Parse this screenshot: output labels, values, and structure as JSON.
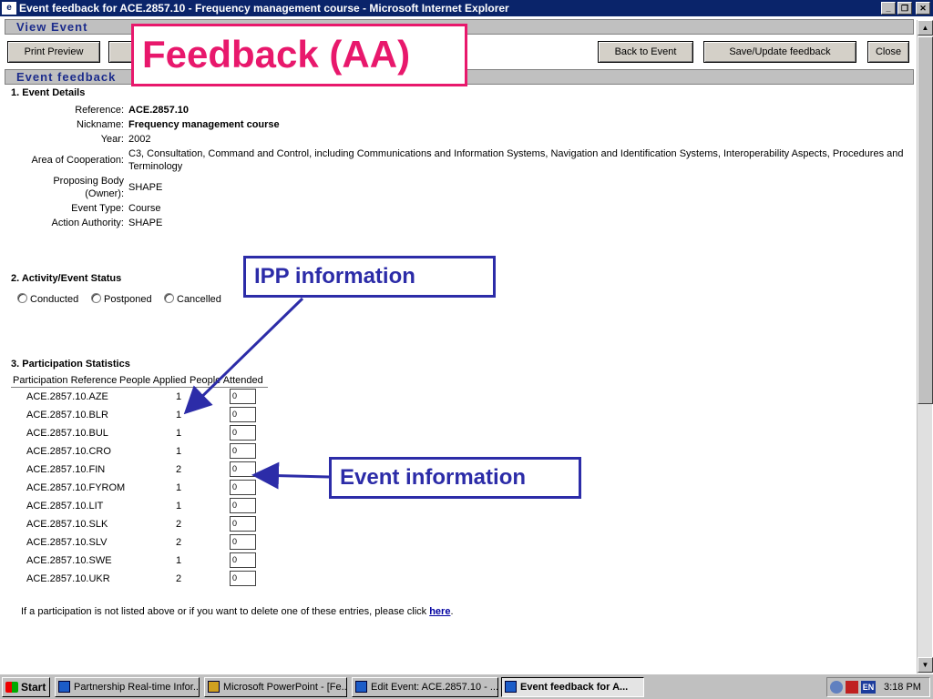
{
  "window": {
    "title": "Event feedback for ACE.2857.10 - Frequency management course - Microsoft Internet Explorer",
    "minimize": "_",
    "restore": "❐",
    "close": "✕"
  },
  "view_bar": {
    "title": "View Event"
  },
  "toolbar": {
    "print_preview": "Print Preview",
    "back_to_event": "Back to Event",
    "save_update": "Save/Update feedback",
    "close": "Close"
  },
  "feedback_bar": {
    "title": "Event feedback"
  },
  "event_details": {
    "heading": "1. Event Details",
    "reference_label": "Reference:",
    "reference": "ACE.2857.10",
    "nickname_label": "Nickname:",
    "nickname": "Frequency management course",
    "year_label": "Year:",
    "year": "2002",
    "area_label": "Area of Cooperation:",
    "area_line1": "C3, Consultation, Command and Control, including Communications and Information Systems, Navigation and Identification Systems, Interoperability Aspects, Procedures and",
    "area_line2": "Terminology",
    "proposing_label_1": "Proposing Body",
    "proposing_label_2": "(Owner):",
    "proposing": "SHAPE",
    "event_type_label": "Event Type:",
    "event_type": "Course",
    "action_authority_label": "Action Authority:",
    "action_authority": "SHAPE"
  },
  "status": {
    "heading": "2. Activity/Event Status",
    "options": [
      "Conducted",
      "Postponed",
      "Cancelled"
    ]
  },
  "participation": {
    "heading": "3. Participation Statistics",
    "col_ref": "Participation Reference",
    "col_applied": "People Applied",
    "col_attended": "People Attended",
    "rows": [
      {
        "ref": "ACE.2857.10.AZE",
        "applied": "1",
        "attended": "0"
      },
      {
        "ref": "ACE.2857.10.BLR",
        "applied": "1",
        "attended": "0"
      },
      {
        "ref": "ACE.2857.10.BUL",
        "applied": "1",
        "attended": "0"
      },
      {
        "ref": "ACE.2857.10.CRO",
        "applied": "1",
        "attended": "0"
      },
      {
        "ref": "ACE.2857.10.FIN",
        "applied": "2",
        "attended": "0"
      },
      {
        "ref": "ACE.2857.10.FYROM",
        "applied": "1",
        "attended": "0"
      },
      {
        "ref": "ACE.2857.10.LIT",
        "applied": "1",
        "attended": "0"
      },
      {
        "ref": "ACE.2857.10.SLK",
        "applied": "2",
        "attended": "0"
      },
      {
        "ref": "ACE.2857.10.SLV",
        "applied": "2",
        "attended": "0"
      },
      {
        "ref": "ACE.2857.10.SWE",
        "applied": "1",
        "attended": "0"
      },
      {
        "ref": "ACE.2857.10.UKR",
        "applied": "2",
        "attended": "0"
      }
    ],
    "note_text": "If a participation is not listed above or if you want to delete one of these entries, please click ",
    "note_link": "here",
    "note_end": "."
  },
  "callouts": {
    "main": "Feedback (AA)",
    "ipp": "IPP information",
    "event": "Event information",
    "color_main": "#e8186c",
    "color_sub": "#2c2ca8"
  },
  "scrollbar": {
    "up": "▲",
    "down": "▼"
  },
  "taskbar": {
    "start": "Start",
    "tasks": [
      "Partnership Real-time Infor...",
      "Microsoft PowerPoint - [Fe...",
      "Edit Event: ACE.2857.10 - ...",
      "Event feedback for A..."
    ],
    "language": "EN",
    "clock": "3:18 PM"
  }
}
